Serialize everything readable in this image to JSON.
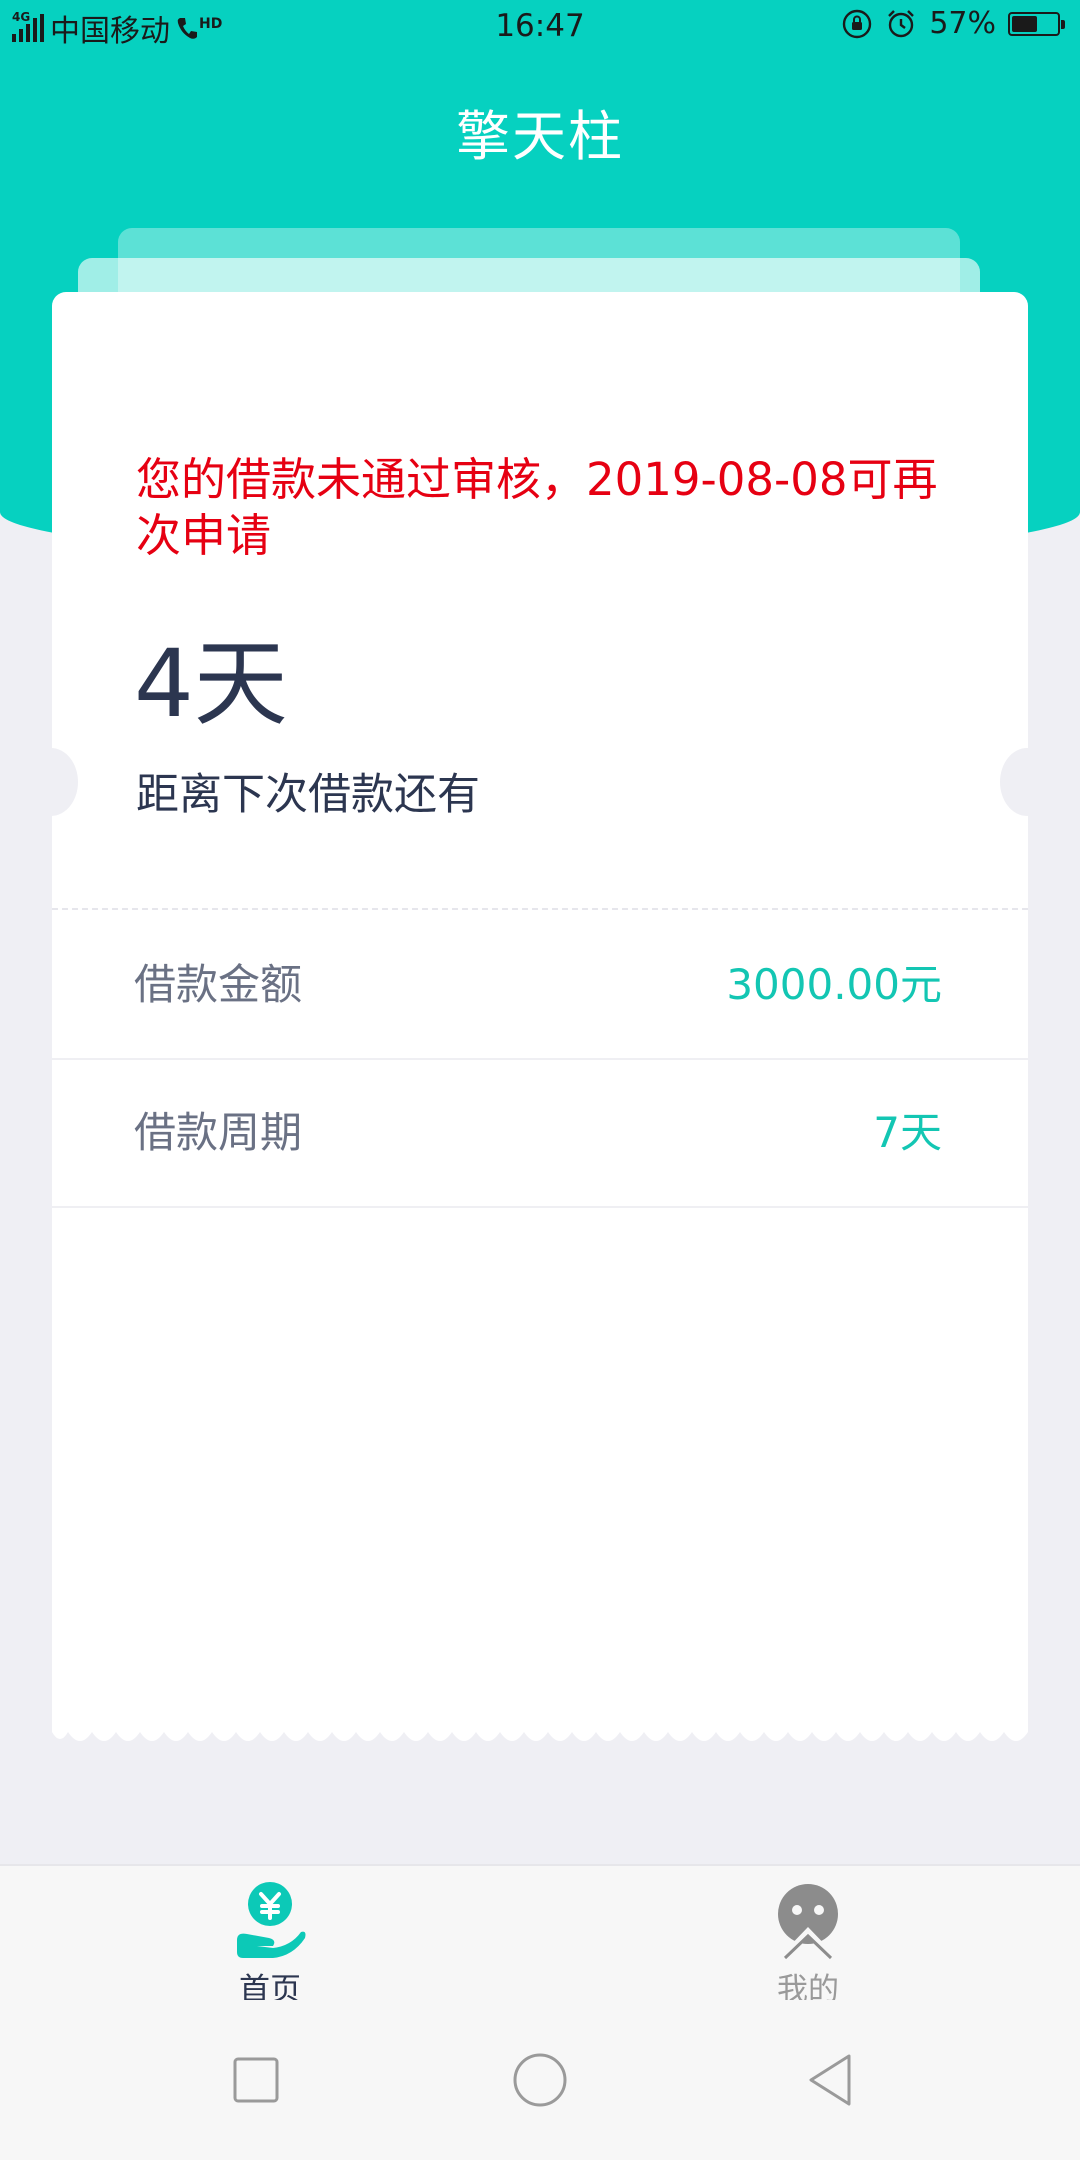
{
  "status_bar": {
    "network": "4G",
    "carrier": "中国移动",
    "hd": "HD",
    "time": "16:47",
    "battery_percent": "57%",
    "battery_level": 0.57
  },
  "header": {
    "title": "擎天柱"
  },
  "card": {
    "notice": "您的借款未通过审核，2019-08-08可再次申请",
    "days": "4天",
    "days_label": "距离下次借款还有",
    "rows": [
      {
        "label": "借款金额",
        "value": "3000.00元"
      },
      {
        "label": "借款周期",
        "value": "7天"
      }
    ]
  },
  "tab_bar": {
    "items": [
      {
        "label": "首页",
        "icon": "home-yuan-hand-icon",
        "active": true
      },
      {
        "label": "我的",
        "icon": "profile-face-icon",
        "active": false
      }
    ]
  },
  "colors": {
    "brand": "#06d1c0",
    "value_text": "#13c6b3",
    "alert_text": "#e60012",
    "primary_text": "#2c3650",
    "background": "#efeff4"
  }
}
